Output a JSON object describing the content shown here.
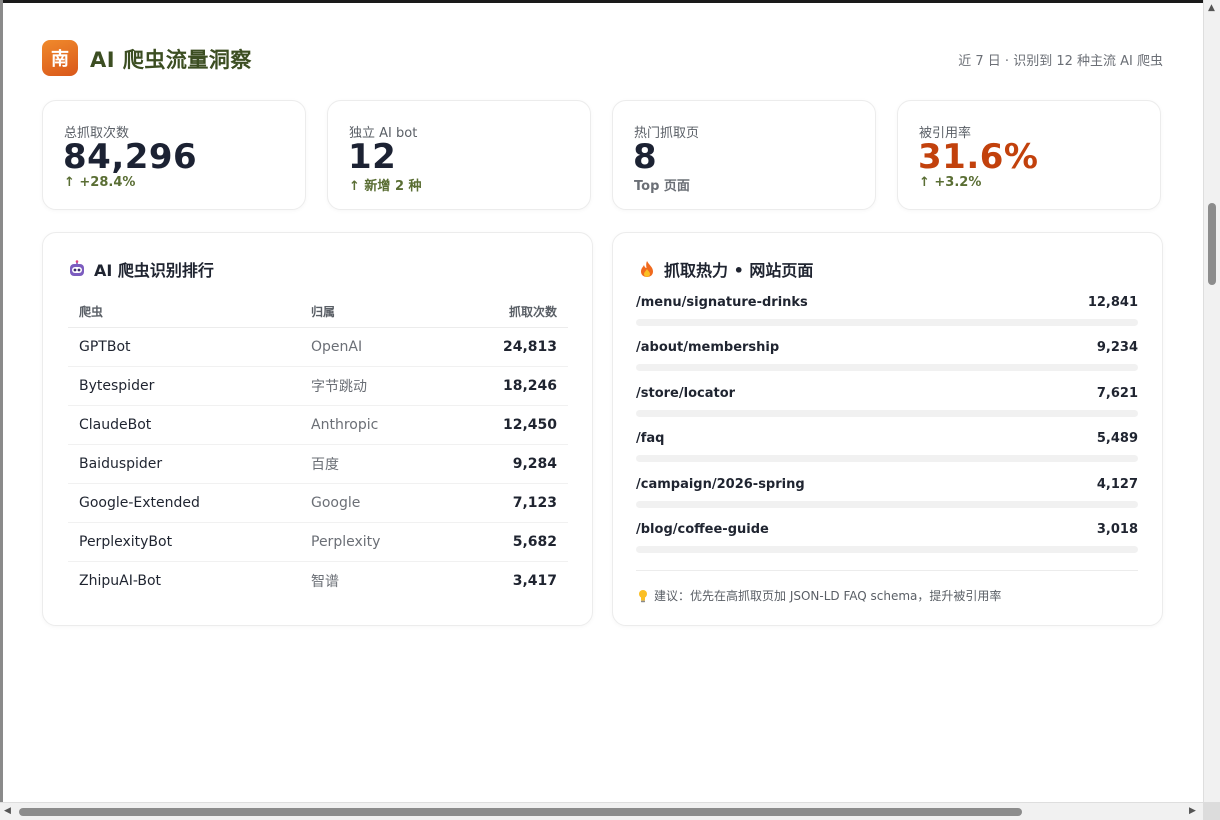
{
  "header": {
    "logo_char": "南",
    "title": "AI 爬虫流量洞察",
    "subtitle": "近 7 日 · 识别到 12 种主流 AI 爬虫"
  },
  "stats": [
    {
      "label": "总抓取次数",
      "value": "84,296",
      "delta": "↑ +28.4%"
    },
    {
      "label": "独立 AI bot",
      "value": "12",
      "delta": "↑ 新增 2 种"
    },
    {
      "label": "热门抓取页",
      "value": "8",
      "delta": "Top 页面"
    },
    {
      "label": "被引用率",
      "value": "31.6%",
      "delta": "↑ +3.2%"
    }
  ],
  "colors": {
    "accent": "#c2410c",
    "title": "#3c4e22",
    "positive": "#5a6e34"
  },
  "bots_card": {
    "title": "AI 爬虫识别排行",
    "icon": "robot-icon",
    "columns": [
      "爬虫",
      "归属",
      "抓取次数"
    ],
    "rows": [
      {
        "name": "GPTBot",
        "owner": "OpenAI",
        "count": "24,813"
      },
      {
        "name": "Bytespider",
        "owner": "字节跳动",
        "count": "18,246"
      },
      {
        "name": "ClaudeBot",
        "owner": "Anthropic",
        "count": "12,450"
      },
      {
        "name": "Baiduspider",
        "owner": "百度",
        "count": "9,284"
      },
      {
        "name": "Google-Extended",
        "owner": "Google",
        "count": "7,123"
      },
      {
        "name": "PerplexityBot",
        "owner": "Perplexity",
        "count": "5,682"
      },
      {
        "name": "ZhipuAI-Bot",
        "owner": "智谱",
        "count": "3,417"
      }
    ]
  },
  "pages_card": {
    "title": "抓取热力 • 网站页面",
    "icon": "fire-icon",
    "rows": [
      {
        "path": "/menu/signature-drinks",
        "count": "12,841"
      },
      {
        "path": "/about/membership",
        "count": "9,234"
      },
      {
        "path": "/store/locator",
        "count": "7,621"
      },
      {
        "path": "/faq",
        "count": "5,489"
      },
      {
        "path": "/campaign/2026-spring",
        "count": "4,127"
      },
      {
        "path": "/blog/coffee-guide",
        "count": "3,018"
      }
    ],
    "tip_icon": "lightbulb-icon",
    "tip": "建议：优先在高抓取页加 JSON-LD FAQ schema，提升被引用率"
  }
}
